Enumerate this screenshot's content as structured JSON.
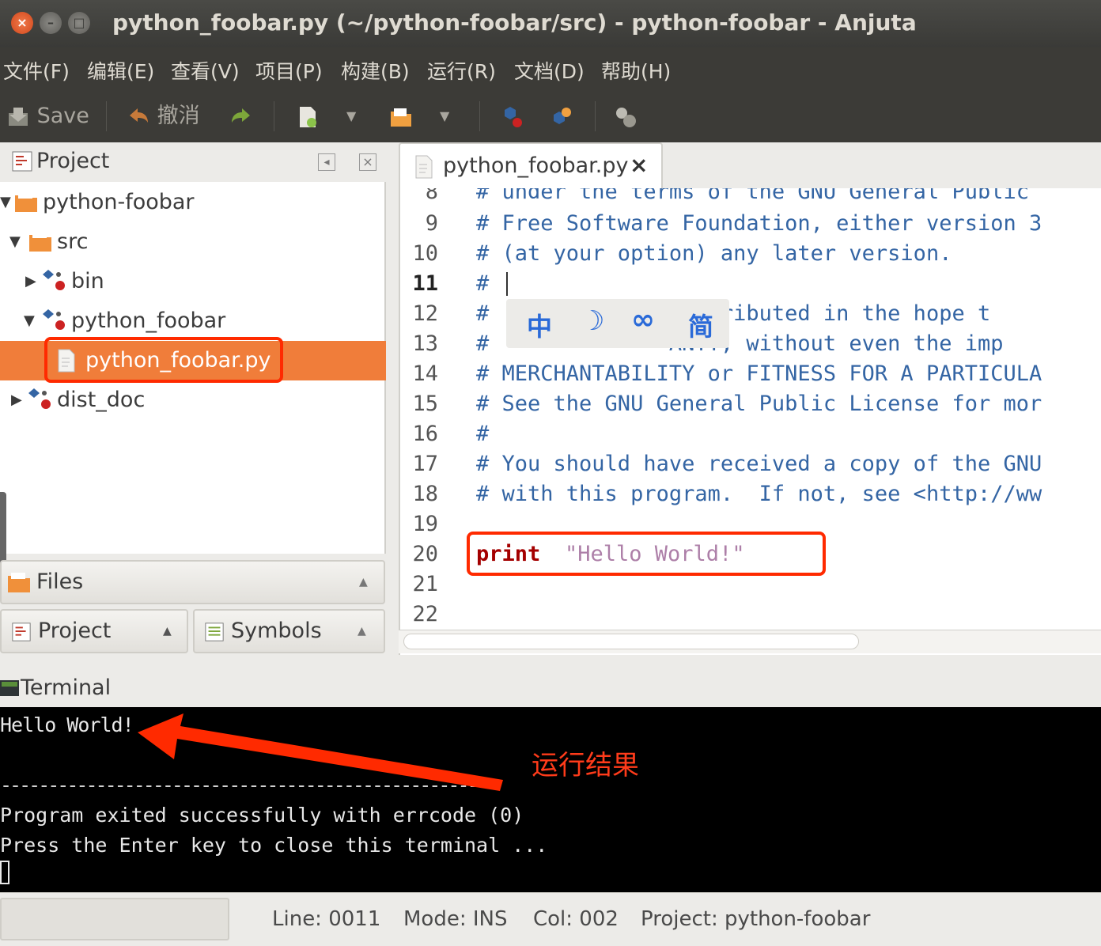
{
  "window": {
    "title": "python_foobar.py (~/python-foobar/src) - python-foobar - Anjuta",
    "close_glyph": "×",
    "min_glyph": "–",
    "max_glyph": "□"
  },
  "menu": [
    "文件(F)",
    "编辑(E)",
    "查看(V)",
    "项目(P)",
    "构建(B)",
    "运行(R)",
    "文档(D)",
    "帮助(H)"
  ],
  "toolbar": {
    "save_label": "Save",
    "undo_label": "撤消"
  },
  "project_panel": {
    "title": "Project",
    "tree": [
      {
        "label": "python-foobar",
        "expanded": true
      },
      {
        "label": "src",
        "expanded": true
      },
      {
        "label": "bin",
        "expanded": false
      },
      {
        "label": "python_foobar",
        "expanded": true
      },
      {
        "label": "python_foobar.py",
        "selected": true
      },
      {
        "label": "dist_doc",
        "expanded": false
      }
    ]
  },
  "side_tabs": {
    "files": "Files",
    "project": "Project",
    "symbols": "Symbols"
  },
  "editor": {
    "tab_label": "python_foobar.py",
    "close_glyph": "×",
    "lines": [
      {
        "n": "8",
        "text": "# under the terms of the GNU General Public"
      },
      {
        "n": "9",
        "text": "# Free Software Foundation, either version 3"
      },
      {
        "n": "10",
        "text": "# (at your option) any later version."
      },
      {
        "n": "11",
        "text": "#"
      },
      {
        "n": "12",
        "text": "#              distributed in the hope t"
      },
      {
        "n": "13",
        "text": "#              ANTY; without even the imp"
      },
      {
        "n": "14",
        "text": "# MERCHANTABILITY or FITNESS FOR A PARTICULA"
      },
      {
        "n": "15",
        "text": "# See the GNU General Public License for mor"
      },
      {
        "n": "16",
        "text": "#"
      },
      {
        "n": "17",
        "text": "# You should have received a copy of the GNU"
      },
      {
        "n": "18",
        "text": "# with this program.  If not, see <http://ww"
      },
      {
        "n": "19",
        "text": ""
      },
      {
        "n": "20",
        "keyword": "print",
        "string": "\"Hello World!\""
      },
      {
        "n": "21",
        "text": ""
      },
      {
        "n": "22",
        "text": ""
      }
    ]
  },
  "ime": [
    "中",
    "☽",
    "∞",
    "简"
  ],
  "terminal": {
    "title": "Terminal",
    "output": "Hello World!",
    "divider": "----------------------------------------------------",
    "exit_message": "Program exited successfully with errcode (0)",
    "press_message": "Press the Enter key to close this terminal ..."
  },
  "annotation": "运行结果",
  "status": {
    "line": "Line: 0011",
    "mode": "Mode: INS",
    "col": "Col: 002",
    "project": "Project: python-foobar"
  },
  "colors": {
    "accent_orange": "#f07d3a",
    "annotation_red": "#ff2a00",
    "comment_blue": "#3465a4",
    "keyword": "#a40000",
    "string": "#ad7fa8"
  }
}
